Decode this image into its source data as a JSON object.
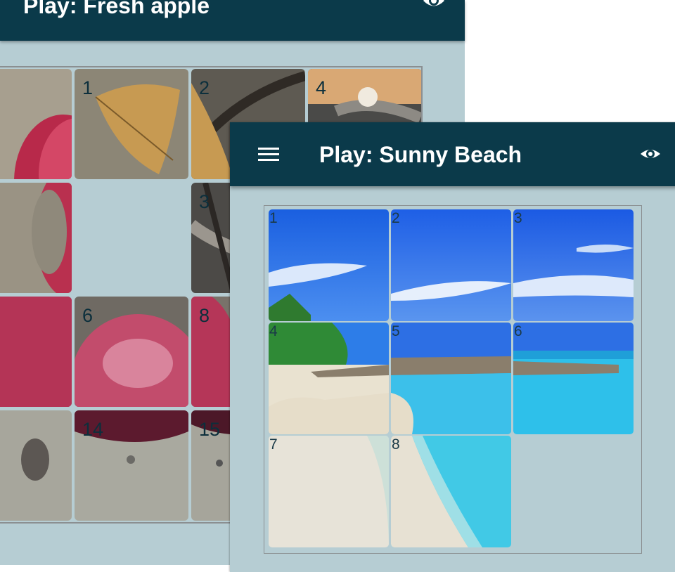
{
  "back_window": {
    "title": "Play: Fresh apple",
    "icons": {
      "visibility": "eye-icon"
    },
    "tiles": [
      {
        "number": "",
        "image": "apple-core-left"
      },
      {
        "number": "1",
        "image": "dry-leaf"
      },
      {
        "number": "2",
        "image": "leaf-branch"
      },
      {
        "number": "4",
        "image": "blossom-branch"
      },
      {
        "number": "",
        "image": "apple-side"
      },
      {
        "number": "3",
        "image": "branch-dark"
      },
      {
        "number": "",
        "image": "apple-red"
      },
      {
        "number": "6",
        "image": "apple-drops"
      },
      {
        "number": "8",
        "image": "apple-edge"
      },
      {
        "number": "",
        "image": "apple-stem"
      },
      {
        "number": "14",
        "image": "apple-bottom"
      },
      {
        "number": "15",
        "image": "water-drops"
      }
    ]
  },
  "front_window": {
    "title": "Play: Sunny Beach",
    "icons": {
      "menu": "hamburger-menu-icon",
      "visibility": "eye-icon"
    },
    "tiles": [
      {
        "number": "1"
      },
      {
        "number": "2"
      },
      {
        "number": "3"
      },
      {
        "number": "4"
      },
      {
        "number": "5"
      },
      {
        "number": "6"
      },
      {
        "number": "7"
      },
      {
        "number": "8"
      }
    ],
    "empty_slot": "bottom-right"
  },
  "colors": {
    "appbar": "#0b3a4a",
    "background": "#b6cdd3",
    "tile_number": "#0c2f3c"
  }
}
